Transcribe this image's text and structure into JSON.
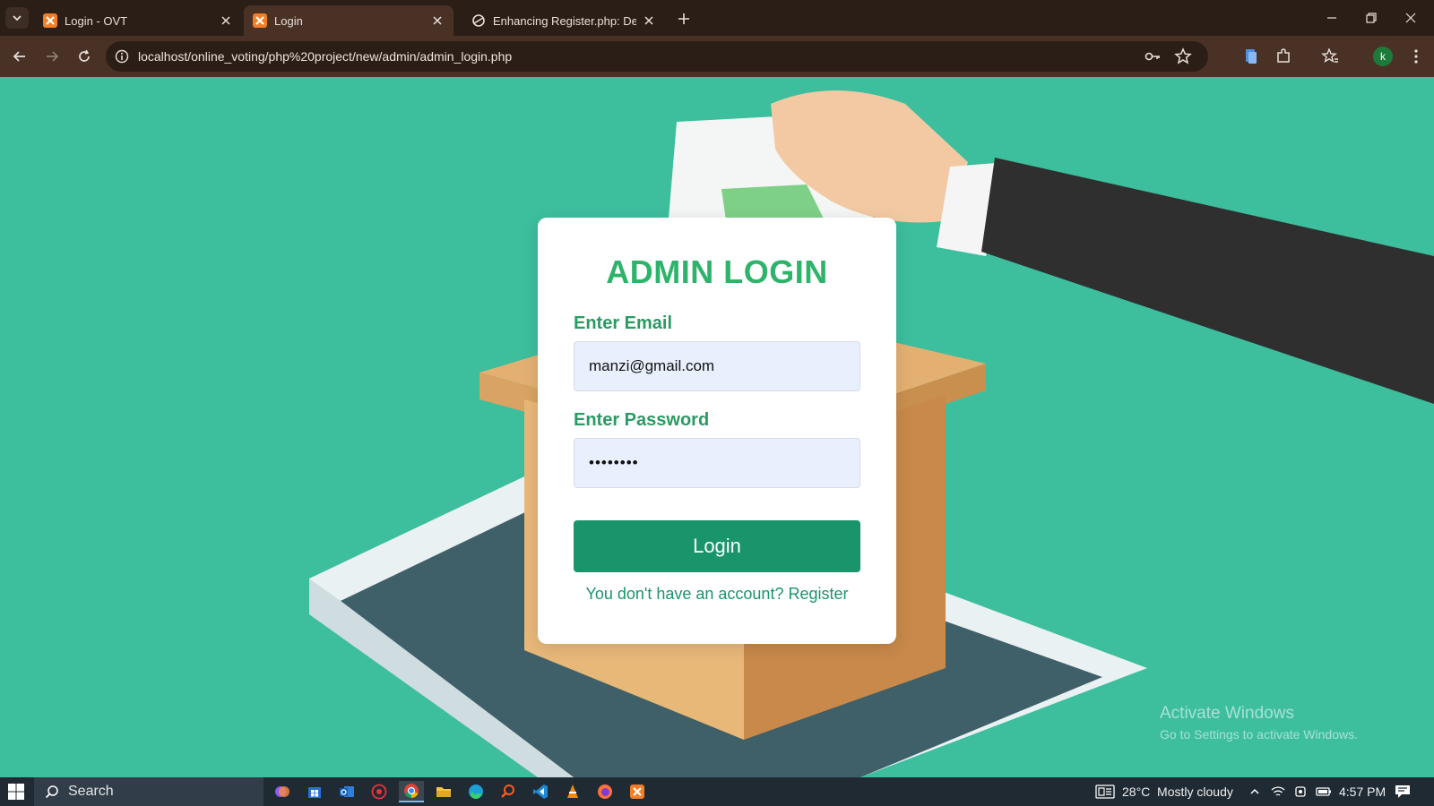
{
  "browser": {
    "tabs": [
      {
        "title": "Login - OVT",
        "favicon": "xampp-icon"
      },
      {
        "title": "Login",
        "favicon": "xampp-icon",
        "active": true
      },
      {
        "title": "Enhancing Register.php: Design",
        "favicon": "openai-icon"
      }
    ],
    "url": "localhost/online_voting/php%20project/new/admin/admin_login.php",
    "profile_initial": "k"
  },
  "page": {
    "heading": "ADMIN LOGIN",
    "email_label": "Enter Email",
    "email_value": "manzi@gmail.com",
    "password_label": "Enter Password",
    "password_value": "••••••••",
    "login_button": "Login",
    "register_text": "You don't have an account? Register",
    "watermark_title": "Activate Windows",
    "watermark_sub": "Go to Settings to activate Windows."
  },
  "taskbar": {
    "search_placeholder": "Search",
    "weather": "28°C  Mostly cloudy",
    "time": "4:57 PM"
  },
  "colors": {
    "accent_green": "#2db36a",
    "button_green": "#1a946b",
    "page_background": "#3dbe9d",
    "browser_chrome": "#4a3126"
  }
}
